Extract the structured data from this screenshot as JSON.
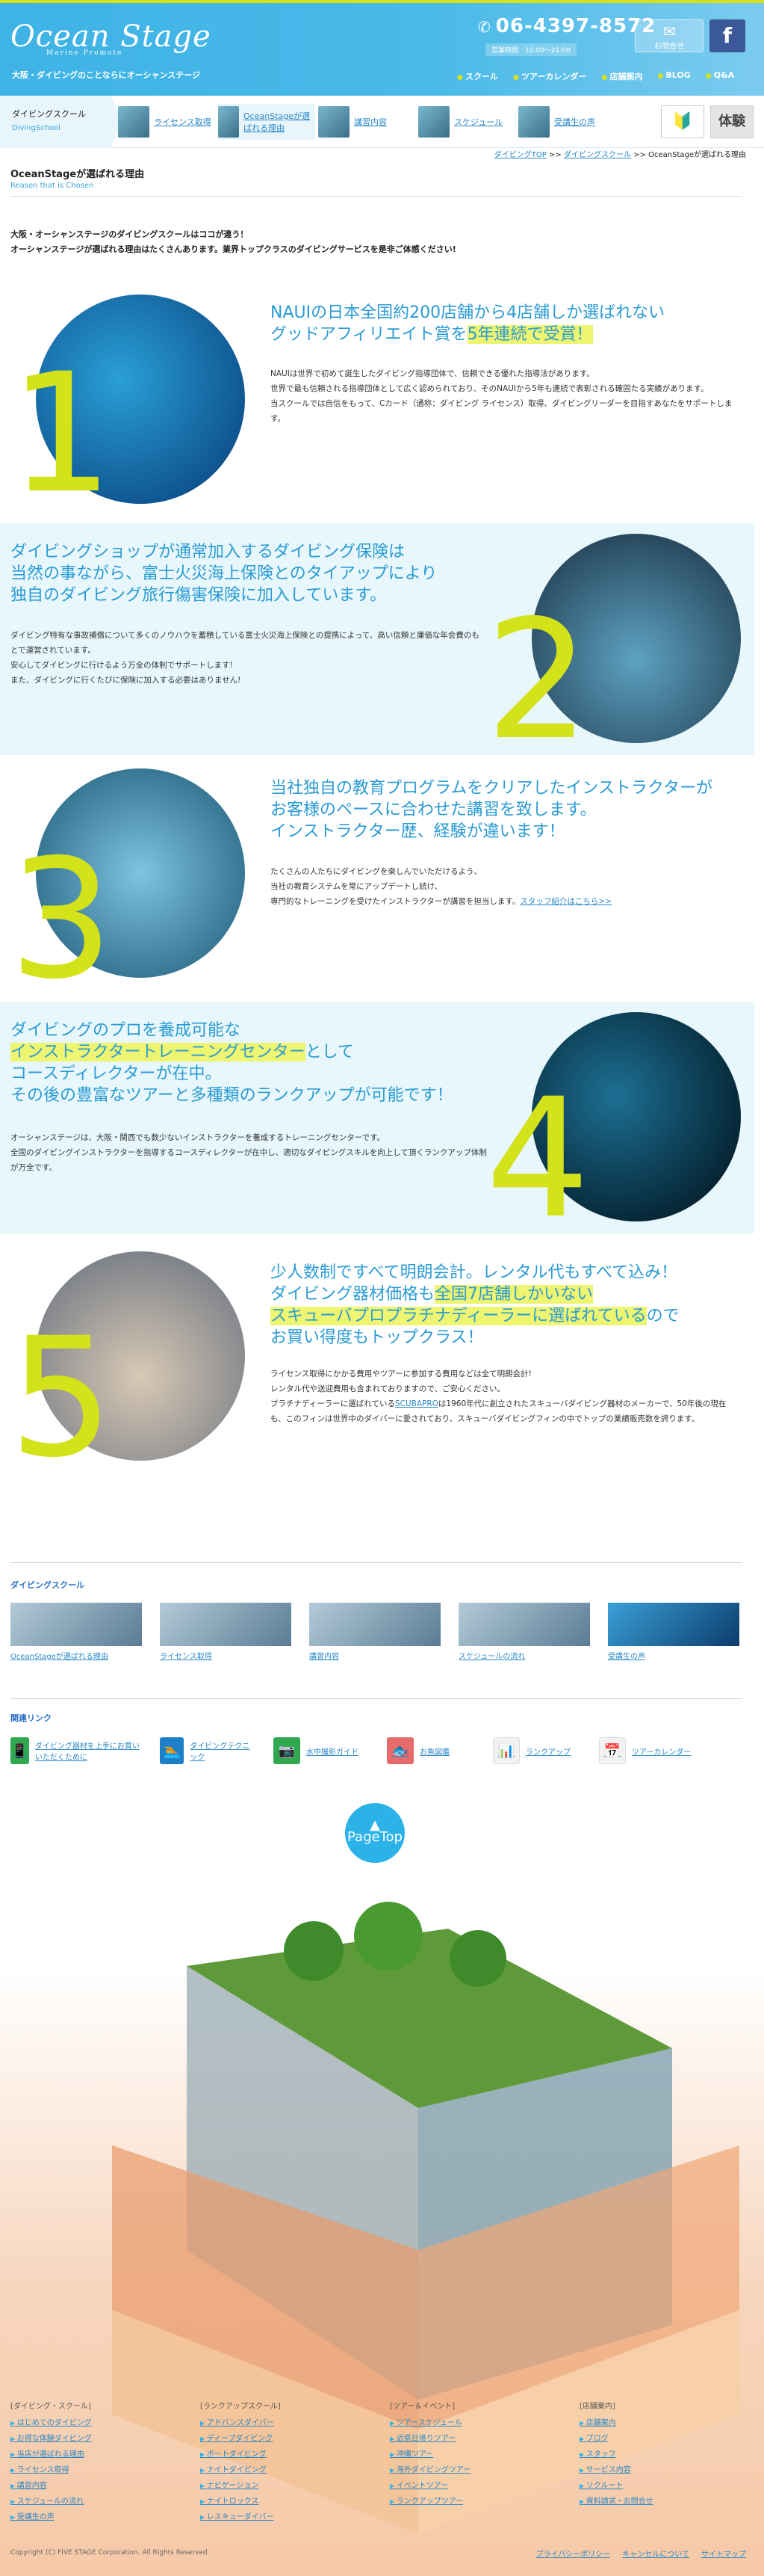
{
  "header": {
    "logo": "Ocean Stage",
    "logo_sub": "Marine Promote",
    "tagline": "大阪・ダイビングのことならにオーシャンステージ",
    "phone": "06-4397-8572",
    "hours": "営業時間　10:00〜21:00",
    "contact_label": "お問合せ",
    "fb_label": "f",
    "links": [
      "スクール",
      "ツアーカレンダー",
      "店舗案内",
      "BLOG",
      "Q&A"
    ]
  },
  "nav": {
    "title": "ダイビングスクール",
    "subtitle": "DivingSchool",
    "items": [
      "ライセンス取得",
      "OceanStageが選ばれる理由",
      "講習内容",
      "スケジュール",
      "受講生の声"
    ],
    "wakaba_icon": "🔰",
    "taiken_label": "体験"
  },
  "breadcrumb": {
    "items": [
      "ダイビングTOP",
      "ダイビングスクール"
    ],
    "current": "OceanStageが選ばれる理由",
    "sep": ">>"
  },
  "page": {
    "title": "OceanStageが選ばれる理由",
    "subtitle": "Reason that is Chosen",
    "intro1": "大阪・オーシャンステージのダイビングスクールはココが違う！",
    "intro2": "オーシャンステージが選ばれる理由はたくさんあります。業界トップクラスのダイビングサービスを是非ご体感ください!"
  },
  "reasons": [
    {
      "num": "1",
      "h1": "NAUIの日本全国約200店舗から4店舗しか選ばれない",
      "h2a": "グッドアフィリエイト賞を",
      "h2b": "5年連続で受賞！",
      "b1": "NAUIは世界で初めて誕生したダイビング指導団体で、信頼できる優れた指導法があります。",
      "b2": "世界で最も信頼される指導団体として広く認められており、そのNAUIから5年も連続で表彰される確固たる実績があります。",
      "b3": "当スクールでは自信をもって、Cカード（通称：ダイビング ライセンス）取得、ダイビングリーダーを目指すあなたをサポートします。"
    },
    {
      "num": "2",
      "h1": "ダイビングショップが通常加入するダイビング保険は",
      "h2": "当然の事ながら、富士火災海上保険とのタイアップにより",
      "h3": "独自のダイビング旅行傷害保険に加入しています。",
      "b1": "ダイビング特有な事故補償について多くのノウハウを蓄積している富士火災海上保険との提携によって、高い信頼と廉価な年会費のもとで運営されています。",
      "b2": "安心してダイビングに行けるよう万全の体制でサポートします!",
      "b3": "また、ダイビングに行くたびに保険に加入する必要はありません!"
    },
    {
      "num": "3",
      "h1": "当社独自の教育プログラムをクリアしたインストラクターが",
      "h2": "お客様のペースに合わせた講習を致します。",
      "h3": "インストラクター歴、経験が違います！",
      "b1": "たくさんの人たちにダイビングを楽しんでいただけるよう、",
      "b2": "当社の教育システムを常にアップデートし続け、",
      "b3": "専門的なトレーニングを受けたインストラクターが講習を担当します。",
      "link": "スタッフ紹介はこちら>>"
    },
    {
      "num": "4",
      "h1": "ダイビングのプロを養成可能な",
      "h2a": "インストラクタートレーニングセンター",
      "h2b": "として",
      "h3": "コースディレクターが在中。",
      "h4": "その後の豊富なツアーと多種類のランクアップが可能です！",
      "b1": "オーシャンステージは、大阪・関西でも数少ないインストラクターを養成するトレーニングセンターです。",
      "b2": "全国のダイビングインストラクターを指導するコースディレクターが在中し、適切なダイビングスキルを向上して頂くランクアップ体制が万全です。"
    },
    {
      "num": "5",
      "h1": "少人数制ですべて明朗会計。レンタル代もすべて込み！",
      "h2a": "ダイビング器材価格も",
      "h2b": "全国7店舗しかいない",
      "h3a": "スキューバプロプラチナディーラーに選ばれている",
      "h3b": "ので",
      "h4": "お買い得度もトップクラス！",
      "b1": "ライセンス取得にかかる費用やツアーに参加する費用などは全て明朗会計!",
      "b2": "レンタル代や送迎費用も含まれておりますので、ご安心ください。",
      "b3a": "プラチナディーラーに選ばれている",
      "b3link": "SCUBAPRO",
      "b3b": "は1960年代に創立されたスキューバダイビング器材のメーカーで、50年後の現在も、このフィンは世界中のダイバーに愛されており、スキューバダイビングフィンの中でトップの業績販売数を誇ります。"
    }
  ],
  "school_section": {
    "title": "ダイビングスクール",
    "items": [
      "OceanStageが選ばれる理由",
      "ライセンス取得",
      "講習内容",
      "スケジュールの流れ",
      "受講生の声"
    ]
  },
  "related": {
    "title": "関連リンク",
    "items": [
      {
        "label": "ダイビング器材を上手にお買いいただくために",
        "icon": "📱",
        "color": "#2fa84f"
      },
      {
        "label": "ダイビングテクニック",
        "icon": "🏊",
        "color": "#1d7fc6"
      },
      {
        "label": "水中撮影ガイド",
        "icon": "📷",
        "color": "#2fa84f"
      },
      {
        "label": "お魚図鑑",
        "icon": "🐟",
        "color": "#e86b6b"
      },
      {
        "label": "ランクアップ",
        "icon": "📊",
        "color": "#f2f2f2"
      },
      {
        "label": "ツアーカレンダー",
        "icon": "📅",
        "color": "#f2f2f2"
      }
    ]
  },
  "pagetop": {
    "arrow": "▲",
    "label": "PageTop"
  },
  "footer": {
    "cols": [
      {
        "title": "[ダイビング・スクール]",
        "items": [
          "はじめてのダイビング",
          "お得な体験ダイビング",
          "当店が選ばれる理由",
          "ライセンス取得",
          "講習内容",
          "スケジュールの流れ",
          "受講生の声"
        ]
      },
      {
        "title": "[ランクアップスクール]",
        "items": [
          "アドバンスダイバー",
          "ディープダイビング",
          "ボートダイビング",
          "ナイトダイビング",
          "ナビゲーション",
          "ナイトロックス",
          "レスキューダイバー"
        ]
      },
      {
        "title": "[ツアー＆イベント]",
        "items": [
          "ツアースケジュール",
          "近県日帰りツアー",
          "沖縄ツアー",
          "海外ダイビングツアー",
          "イベントツアー",
          "ランクアップツアー"
        ]
      },
      {
        "title": "[店舗案内]",
        "items": [
          "店舗案内",
          "ブログ",
          "スタッフ",
          "サービス内容",
          "リクルート",
          "資料請求・お問合せ"
        ]
      }
    ],
    "copyright": "Copyright (C) FIVE STAGE Corporation. All Rights Reserved.",
    "links": [
      "プライバシーポリシー",
      "キャンセルについて",
      "サイトマップ"
    ]
  }
}
